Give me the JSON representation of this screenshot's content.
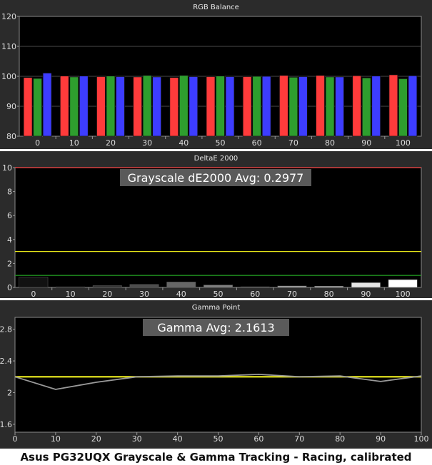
{
  "caption": "Asus PG32UQX Grayscale & Gamma Tracking - Racing, calibrated",
  "chart_data": [
    {
      "type": "bar",
      "title": "RGB Balance",
      "categories": [
        "0",
        "10",
        "20",
        "30",
        "40",
        "50",
        "60",
        "70",
        "80",
        "90",
        "100"
      ],
      "ylim": [
        80,
        120
      ],
      "yticks": [
        80,
        90,
        100,
        110,
        120
      ],
      "series": [
        {
          "color": "#ff3b3b",
          "values": [
            99.6,
            100.1,
            99.9,
            99.8,
            99.6,
            99.9,
            99.9,
            100.3,
            100.3,
            100.2,
            100.5
          ]
        },
        {
          "color": "#2e9e2e",
          "values": [
            99.3,
            99.8,
            100.1,
            100.3,
            100.3,
            100.1,
            100.0,
            99.7,
            99.8,
            99.5,
            99.2
          ]
        },
        {
          "color": "#3d3dff",
          "values": [
            101.1,
            100.1,
            99.9,
            99.8,
            99.9,
            99.9,
            100.0,
            99.9,
            99.8,
            100.1,
            100.2
          ]
        }
      ]
    },
    {
      "type": "bar",
      "title": "DeltaE 2000",
      "annotation": "Grayscale dE2000 Avg: 0.2977",
      "categories": [
        "0",
        "10",
        "20",
        "30",
        "40",
        "50",
        "60",
        "70",
        "80",
        "90",
        "100"
      ],
      "ylim": [
        0,
        10
      ],
      "yticks": [
        0,
        2,
        4,
        6,
        8,
        10
      ],
      "values": [
        0.85,
        0.05,
        0.15,
        0.25,
        0.45,
        0.2,
        0.05,
        0.12,
        0.1,
        0.4,
        0.65
      ],
      "bar_colors": [
        "#111111",
        "#1a1a1a",
        "#333333",
        "#4d4d4d",
        "#666666",
        "#808080",
        "#999999",
        "#b3b3b3",
        "#cccccc",
        "#e6e6e6",
        "#ffffff"
      ],
      "threshold_lines": [
        {
          "value": 10,
          "color": "#ff4a4a"
        },
        {
          "value": 3,
          "color": "#e6e619"
        },
        {
          "value": 1,
          "color": "#1f8f1f"
        }
      ]
    },
    {
      "type": "line",
      "title": "Gamma Point",
      "annotation": "Gamma Avg: 2.1613",
      "x": [
        0,
        10,
        20,
        30,
        40,
        50,
        60,
        70,
        80,
        90,
        100
      ],
      "xticks": [
        0,
        10,
        20,
        30,
        40,
        50,
        60,
        70,
        80,
        90,
        100
      ],
      "ylim": [
        1.5,
        2.95
      ],
      "yticks": [
        1.6,
        2.0,
        2.4,
        2.8
      ],
      "ytick_labels": [
        "1.6",
        "2",
        "2.4",
        "2.8"
      ],
      "series": [
        {
          "color": "#f0f020",
          "values": [
            2.2,
            2.2,
            2.2,
            2.2,
            2.2,
            2.2,
            2.2,
            2.2,
            2.2,
            2.2,
            2.2
          ]
        },
        {
          "color": "#9a9a9a",
          "values": [
            2.2,
            2.04,
            2.13,
            2.2,
            2.21,
            2.21,
            2.23,
            2.2,
            2.21,
            2.14,
            2.21
          ]
        }
      ]
    }
  ]
}
